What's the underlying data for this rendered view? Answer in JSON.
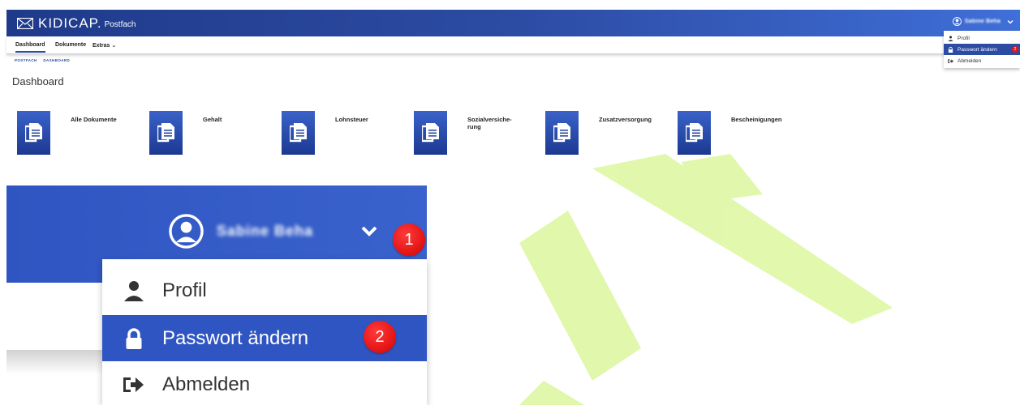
{
  "header": {
    "logo_text": "KIDICAP.",
    "logo_sub": "Postfach",
    "user_name": "Sabine Beha",
    "logo_icon": "envelope-icon",
    "user_icon": "user-circle-icon",
    "menu_icon": "chevron-down-icon"
  },
  "nav": {
    "tabs": [
      {
        "label": "Dashboard",
        "active": true
      },
      {
        "label": "Dokumente",
        "active": false
      },
      {
        "label": "Extras ⌄",
        "active": false
      }
    ]
  },
  "breadcrumb": [
    "POSTFACH",
    "DASHBOARD"
  ],
  "page_title": "Dashboard",
  "tiles": [
    {
      "label": "Alle Dokumente",
      "icon": "document-copy-icon"
    },
    {
      "label": "Gehalt",
      "icon": "document-copy-icon"
    },
    {
      "label": "Lohnsteuer",
      "icon": "document-copy-icon"
    },
    {
      "label": "Sozialversiche-\nrung",
      "icon": "document-copy-icon"
    },
    {
      "label": "Zusatzversorgung",
      "icon": "document-copy-icon"
    },
    {
      "label": "Bescheinigungen",
      "icon": "document-copy-icon"
    }
  ],
  "user_menu": {
    "items": [
      {
        "label": "Profil",
        "icon": "user-icon",
        "active": false
      },
      {
        "label": "Passwort ändern",
        "icon": "lock-icon",
        "active": true
      },
      {
        "label": "Abmelden",
        "icon": "sign-out-icon",
        "active": false
      }
    ]
  },
  "annotations": {
    "step1": "1",
    "step2": "2"
  },
  "colors": {
    "header_dark": "#1f3a8a",
    "header_light": "#3f6fd8",
    "accent": "#2c4ba3",
    "badge": "#e01818",
    "watermark": "#b6ea3a"
  }
}
